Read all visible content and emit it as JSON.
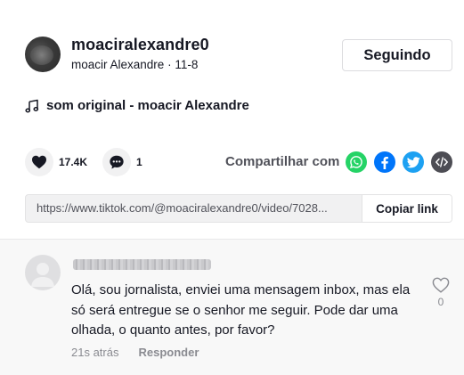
{
  "author": {
    "username": "moaciralexandre0",
    "display_name": "moacir Alexandre",
    "separator": " · ",
    "date": "11-8",
    "follow_label": "Seguindo"
  },
  "music": {
    "icon": "music-note-icon",
    "label": "som original - moacir Alexandre"
  },
  "actions": {
    "likes": {
      "icon": "heart-icon",
      "count": "17.4K"
    },
    "comments": {
      "icon": "comment-icon",
      "count": "1"
    },
    "share_label": "Compartilhar com",
    "share_targets": [
      {
        "name": "whatsapp",
        "icon": "whatsapp-icon",
        "color": "#25d366"
      },
      {
        "name": "facebook",
        "icon": "facebook-icon",
        "color": "#0075fa"
      },
      {
        "name": "twitter",
        "icon": "twitter-icon",
        "color": "#1da1f2"
      },
      {
        "name": "embed",
        "icon": "embed-icon",
        "color": "#4d4d54"
      }
    ]
  },
  "link": {
    "url": "https://www.tiktok.com/@moaciralexandre0/video/7028...",
    "copy_label": "Copiar link"
  },
  "comment": {
    "author_name": "",
    "text": "Olá, sou jornalista, enviei uma mensagem inbox, mas ela só será entregue se o senhor me seguir. Pode dar uma olhada, o quanto antes, por favor?",
    "time": "21s atrás",
    "reply_label": "Responder",
    "like_count": "0"
  }
}
